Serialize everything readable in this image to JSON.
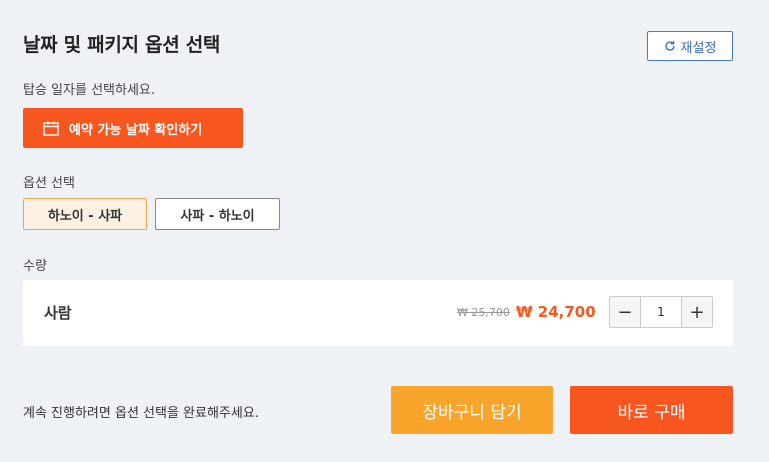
{
  "header": {
    "title": "날짜 및 패키지 옵션 선택",
    "reset_label": "재설정",
    "reset_icon": "refresh-icon"
  },
  "date": {
    "hint": "탑승 일자를 선택하세요.",
    "button_label": "예약 가능 날짜 확인하기",
    "button_icon": "calendar-icon"
  },
  "options": {
    "label": "옵션 선택",
    "items": [
      {
        "label": "하노이 - 사파",
        "selected": true
      },
      {
        "label": "사파 - 하노이",
        "selected": false
      }
    ]
  },
  "quantity": {
    "label": "수량",
    "item_label": "사람",
    "old_price": "₩ 25,700",
    "new_price": "₩ 24,700",
    "value": "1",
    "minus": "−",
    "plus": "+"
  },
  "footer": {
    "note": "계속 진행하려면 옵션 선택을 완료해주세요.",
    "cart_label": "장바구니 담기",
    "buy_label": "바로 구매"
  },
  "colors": {
    "accent": "#f7561f",
    "cart": "#f9a52b",
    "selected_bg": "#fdf1e4",
    "selected_border": "#f0a64a",
    "link_blue": "#3a6bbf"
  }
}
